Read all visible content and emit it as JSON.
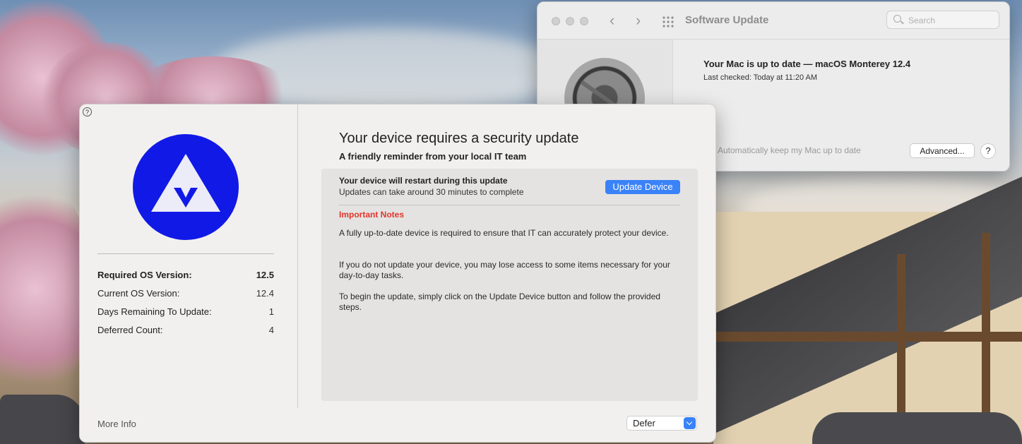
{
  "software_update": {
    "title": "Software Update",
    "search_placeholder": "Search",
    "status_title": "Your Mac is up to date — macOS Monterey 12.4",
    "status_sub": "Last checked: Today at 11:20 AM",
    "auto_update_label": "Automatically keep my Mac up to date",
    "advanced_label": "Advanced...",
    "help_label": "?"
  },
  "nudge": {
    "help_label": "?",
    "headline": "Your device requires a security update",
    "subheadline": "A friendly reminder from your local IT team",
    "info": [
      {
        "label": "Required OS Version:",
        "value": "12.5"
      },
      {
        "label": "Current OS Version:",
        "value": "12.4"
      },
      {
        "label": "Days Remaining To Update:",
        "value": "1"
      },
      {
        "label": "Deferred Count:",
        "value": "4"
      }
    ],
    "more_info_label": "More Info",
    "restart_title": "Your device will restart during this update",
    "restart_sub": "Updates can take around 30 minutes to complete",
    "update_button": "Update Device",
    "notes_title": "Important Notes",
    "notes": [
      "A fully up-to-date device is required to ensure that IT can accurately protect your device.",
      "If you do not update your device, you may lose access to some items necessary for your day-to-day tasks.",
      "To begin the update, simply click on the Update Device button and follow the provided steps."
    ],
    "defer_label": "Defer"
  },
  "colors": {
    "accent": "#3a82f7",
    "logo_blue": "#1119e6",
    "notes_red": "#e0352b"
  }
}
